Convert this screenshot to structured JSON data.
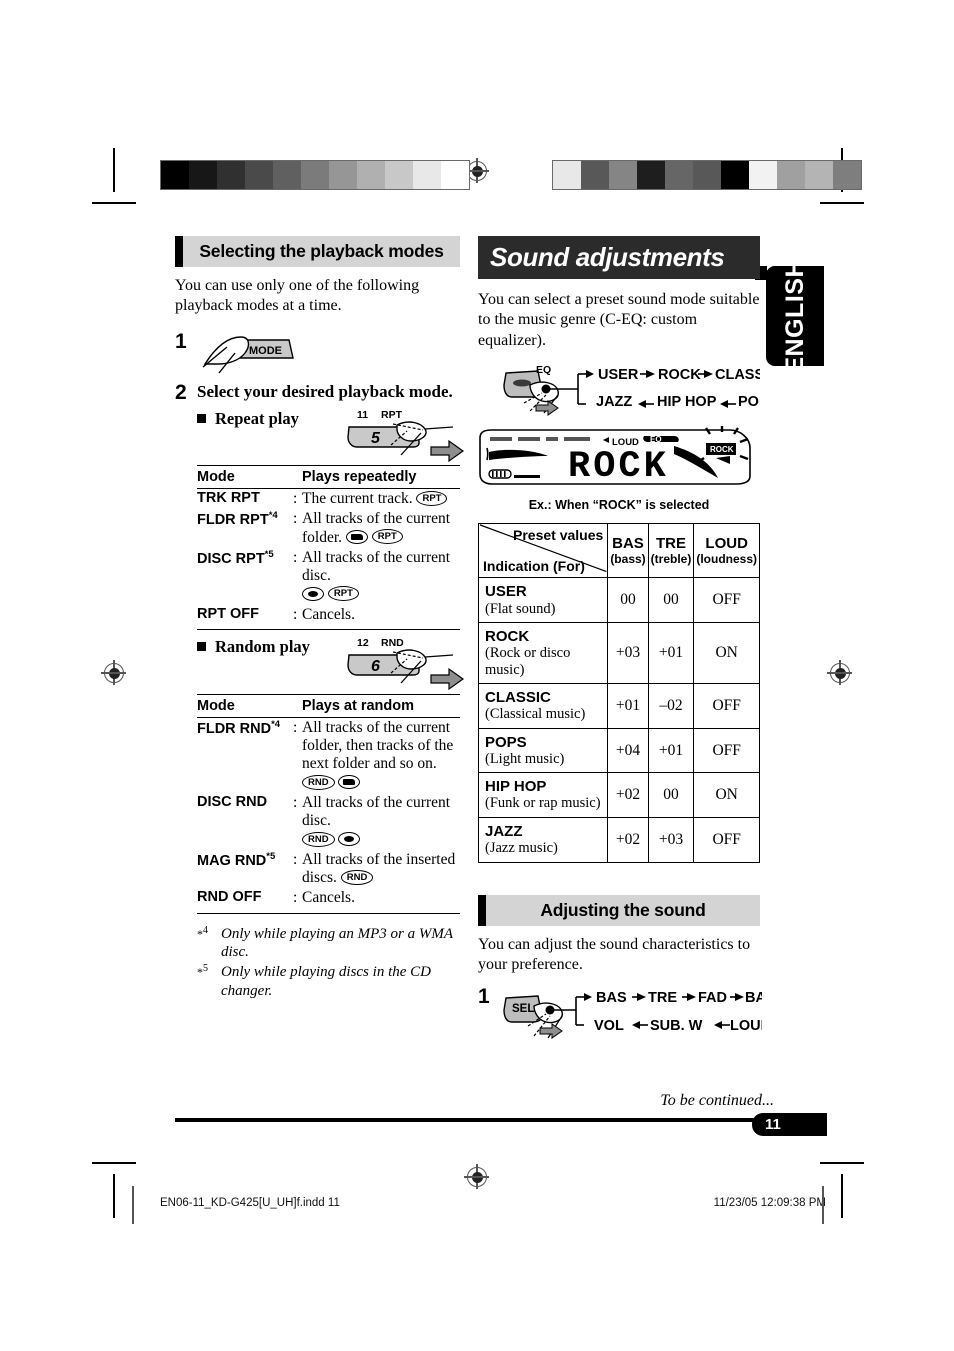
{
  "page": {
    "language_tab": "ENGLISH",
    "page_number": "11",
    "to_be_continued": "To be continued...",
    "slug_left": "EN06-11_KD-G425[U_UH]f.indd   11",
    "slug_right": "11/23/05   12:09:38 PM"
  },
  "left_column": {
    "heading": "Selecting the playback modes",
    "intro": "You can use only one of the following playback modes at a time.",
    "steps": [
      {
        "num": "1",
        "title": "",
        "button_label": "MODE"
      },
      {
        "num": "2",
        "title": "Select your desired playback mode."
      }
    ],
    "repeat": {
      "sub_heading": "Repeat play",
      "button_preset": "11",
      "button_function": "RPT",
      "button_number": "5",
      "col_mode": "Mode",
      "col_desc": "Plays repeatedly",
      "rows": [
        {
          "mode": "TRK RPT",
          "footnote": "",
          "desc": "The current track.",
          "icons": [
            "RPT"
          ]
        },
        {
          "mode": "FLDR RPT",
          "footnote": "*4",
          "desc": "All tracks of the current folder.",
          "icons": [
            "folder",
            "RPT"
          ]
        },
        {
          "mode": "DISC RPT",
          "footnote": "*5",
          "desc": "All tracks of the current disc.",
          "icons": [
            "disc",
            "RPT"
          ]
        },
        {
          "mode": "RPT OFF",
          "footnote": "",
          "desc": "Cancels.",
          "icons": []
        }
      ]
    },
    "random": {
      "sub_heading": "Random play",
      "button_preset": "12",
      "button_function": "RND",
      "button_number": "6",
      "col_mode": "Mode",
      "col_desc": "Plays at random",
      "rows": [
        {
          "mode": "FLDR RND",
          "footnote": "*4",
          "desc": "All tracks of the current folder, then tracks of the next folder and so on.",
          "icons": [
            "RND",
            "folder"
          ]
        },
        {
          "mode": "DISC RND",
          "footnote": "",
          "desc": "All tracks of the current disc.",
          "icons": [
            "RND",
            "disc"
          ]
        },
        {
          "mode": "MAG RND",
          "footnote": "*5",
          "desc": "All tracks of the inserted discs.",
          "icons": [
            "RND"
          ]
        },
        {
          "mode": "RND OFF",
          "footnote": "",
          "desc": "Cancels.",
          "icons": []
        }
      ]
    },
    "footnotes": [
      {
        "mark": "*4",
        "text": "Only while playing an MP3 or a WMA disc."
      },
      {
        "mark": "*5",
        "text": "Only while playing discs in the CD changer."
      }
    ]
  },
  "right_column": {
    "heading": "Sound adjustments",
    "intro": "You can select a preset sound mode suitable to the music genre (C-EQ: custom equalizer).",
    "eq_diagram": {
      "button_label": "EQ",
      "top_row": [
        "USER",
        "ROCK",
        "CLASSIC"
      ],
      "bottom_row": [
        "JAZZ",
        "HIP HOP",
        "POPS"
      ]
    },
    "display": {
      "main_text": "ROCK",
      "indicator_loud": "LOUD",
      "indicator_eq": "EQ",
      "indicator_mode": "ROCK",
      "caption": "Ex.: When “ROCK” is selected"
    },
    "preset_table": {
      "corner_top_right": "Preset values",
      "corner_bottom_left": "Indication (For)",
      "columns": [
        {
          "abbr": "BAS",
          "full": "(bass)"
        },
        {
          "abbr": "TRE",
          "full": "(treble)"
        },
        {
          "abbr": "LOUD",
          "full": "(loudness)"
        }
      ],
      "rows": [
        {
          "name": "USER",
          "for": "(Flat sound)",
          "bas": "00",
          "tre": "00",
          "loud": "OFF"
        },
        {
          "name": "ROCK",
          "for": "(Rock or disco music)",
          "bas": "+03",
          "tre": "+01",
          "loud": "ON"
        },
        {
          "name": "CLASSIC",
          "for": "(Classical music)",
          "bas": "+01",
          "tre": "–02",
          "loud": "OFF"
        },
        {
          "name": "POPS",
          "for": "(Light music)",
          "bas": "+04",
          "tre": "+01",
          "loud": "OFF"
        },
        {
          "name": "HIP HOP",
          "for": "(Funk or rap music)",
          "bas": "+02",
          "tre": "00",
          "loud": "ON"
        },
        {
          "name": "JAZZ",
          "for": "(Jazz music)",
          "bas": "+02",
          "tre": "+03",
          "loud": "OFF"
        }
      ]
    },
    "adjusting": {
      "heading": "Adjusting the sound",
      "intro": "You can adjust the sound characteristics to your preference.",
      "step_num": "1",
      "button_label": "SEL",
      "top_row": [
        "BAS",
        "TRE",
        "FAD",
        "BAL"
      ],
      "bottom_row": [
        "VOL",
        "SUB. W",
        "LOUD"
      ]
    }
  },
  "print_marks": {
    "colorbar_left": [
      "#000000",
      "#171717",
      "#303030",
      "#4a4a4a",
      "#606060",
      "#7b7b7b",
      "#969696",
      "#b0b0b0",
      "#c8c8c8",
      "#e8e8e8",
      "#ffffff"
    ],
    "colorbar_right": [
      "#e8e8e8",
      "#585858",
      "#858585",
      "#1e1e1e",
      "#666666",
      "#585858",
      "#000000",
      "#f2f2f2",
      "#a0a0a0",
      "#b4b4b4",
      "#7e7e7e"
    ]
  }
}
